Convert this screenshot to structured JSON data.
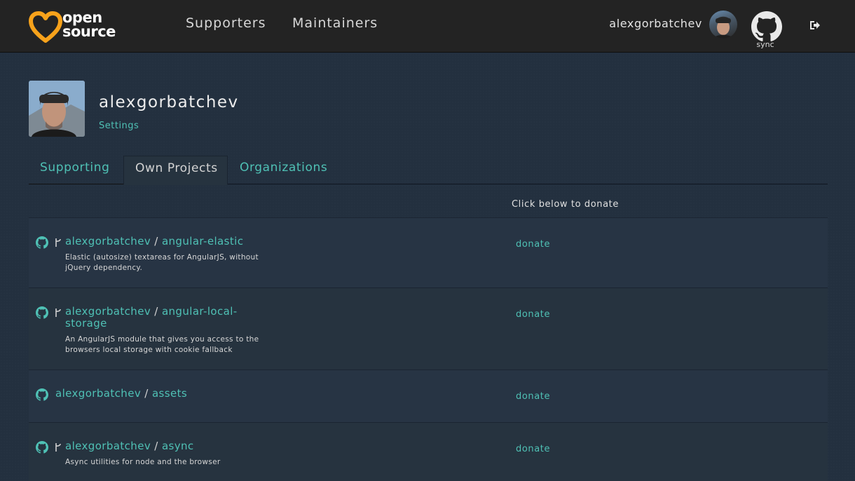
{
  "nav": {
    "logo_line1": "open",
    "logo_line2": "source",
    "links": [
      "Supporters",
      "Maintainers"
    ],
    "username": "alexgorbatchev",
    "sync_label": "sync"
  },
  "profile": {
    "name": "alexgorbatchev",
    "settings_label": "Settings"
  },
  "tabs": [
    "Supporting",
    "Own Projects",
    "Organizations"
  ],
  "donate_header": "Click below to donate",
  "projects": [
    {
      "owner": "alexgorbatchev",
      "separator": "/",
      "repo_line1": "angular-elastic",
      "repo_line2": "",
      "fork": true,
      "description_line1": "Elastic (autosize) textareas for AngularJS, without",
      "description_line2": "jQuery dependency.",
      "donate_label": "donate"
    },
    {
      "owner": "alexgorbatchev",
      "separator": "/",
      "repo_line1": "angular-local-",
      "repo_line2": "storage",
      "fork": true,
      "description_line1": "An AngularJS module that gives you access to the",
      "description_line2": "browsers local storage with cookie fallback",
      "donate_label": "donate"
    },
    {
      "owner": "alexgorbatchev",
      "separator": "/",
      "repo_line1": "assets",
      "repo_line2": "",
      "fork": false,
      "description_line1": "",
      "description_line2": "",
      "donate_label": "donate"
    },
    {
      "owner": "alexgorbatchev",
      "separator": "/",
      "repo_line1": "async",
      "repo_line2": "",
      "fork": true,
      "description_line1": "Async utilities for node and the browser",
      "description_line2": "",
      "donate_label": "donate"
    }
  ],
  "colors": {
    "accent": "#4fc1b5",
    "logo_orange": "#f7a21b",
    "navbar": "#232323",
    "background": "#23303f"
  },
  "icons": [
    "heart-logo-icon",
    "github-icon",
    "fork-icon",
    "sign-out-icon"
  ]
}
